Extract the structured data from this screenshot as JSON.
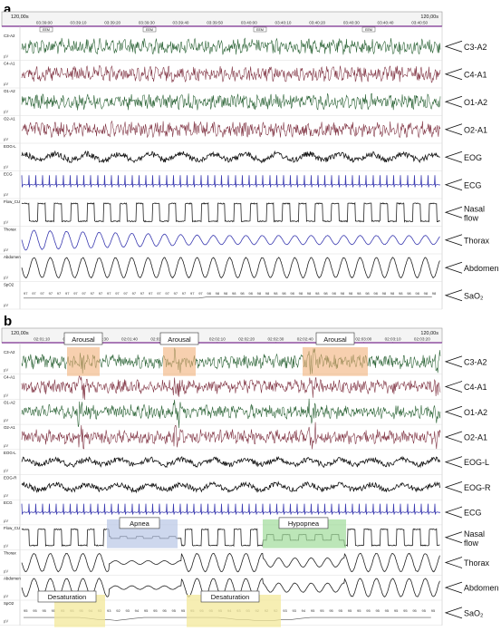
{
  "panel_a": {
    "letter": "a",
    "duration_left": "120,00s",
    "duration_right": "120,00s",
    "time_ticks": [
      "03:39:00",
      "03:39:10",
      "03:39:20",
      "03:39:30",
      "03:39:40",
      "03:39:50",
      "03:40:00",
      "03:40:10",
      "03:40:20",
      "03:40:30",
      "03:40:40",
      "03:40:50"
    ],
    "markers": [
      "EEM",
      "EEM",
      "EEM",
      "EEM",
      "EEM"
    ],
    "channels": [
      {
        "name": "C3-A2",
        "small": "C3-A2",
        "color": "#1f5a2a",
        "type": "eeg"
      },
      {
        "name": "C4-A1",
        "small": "C4-A1",
        "color": "#7a2a3a",
        "type": "eeg"
      },
      {
        "name": "O1-A2",
        "small": "O1-A2",
        "color": "#1f5a2a",
        "type": "eeg"
      },
      {
        "name": "O2-A1",
        "small": "O2-A1",
        "color": "#7a2a3a",
        "type": "eeg"
      },
      {
        "name": "EOG",
        "small": "EOG-L",
        "color": "#111111",
        "type": "eog"
      },
      {
        "name": "ECG",
        "small": "ECG",
        "color": "#3a3ab0",
        "type": "ecg"
      },
      {
        "name": "Nasal flow",
        "small": "Flow_CU",
        "color": "#222222",
        "type": "flow"
      },
      {
        "name": "Thorax",
        "small": "Thorax",
        "color": "#3a3ab0",
        "type": "resp"
      },
      {
        "name": "Abdomen",
        "small": "Abdomen",
        "color": "#222222",
        "type": "resp"
      },
      {
        "name": "SaO₂",
        "small": "SpO2",
        "color": "#222222",
        "type": "sao2"
      }
    ],
    "sao2_values": [
      "97",
      "97",
      "97",
      "97",
      "97",
      "97",
      "97",
      "97",
      "97",
      "97",
      "97",
      "97",
      "97",
      "97",
      "97",
      "97",
      "97",
      "97",
      "97",
      "97",
      "97",
      "97",
      "98",
      "98",
      "98",
      "98",
      "98",
      "98",
      "98",
      "98",
      "98",
      "98",
      "98",
      "98",
      "98",
      "98",
      "98",
      "98",
      "98",
      "98",
      "98",
      "98",
      "98",
      "98",
      "98",
      "98",
      "98",
      "98",
      "98",
      "98"
    ]
  },
  "panel_b": {
    "letter": "b",
    "duration_left": "120,00s",
    "duration_right": "120,00s",
    "time_ticks": [
      "02:01:10",
      "02:01:20",
      "02:01:30",
      "02:01:40",
      "02:01:50",
      "02:02:00",
      "02:02:10",
      "02:02:20",
      "02:02:30",
      "02:02:40",
      "02:02:50",
      "02:03:00",
      "02:03:10",
      "02:03:20"
    ],
    "channels": [
      {
        "name": "C3-A2",
        "small": "C3-A2",
        "color": "#1f5a2a",
        "type": "eeg"
      },
      {
        "name": "C4-A1",
        "small": "C4-A1",
        "color": "#7a2a3a",
        "type": "eeg"
      },
      {
        "name": "O1-A2",
        "small": "O1-A2",
        "color": "#1f5a2a",
        "type": "eeg"
      },
      {
        "name": "O2-A1",
        "small": "O2-A1",
        "color": "#7a2a3a",
        "type": "eeg"
      },
      {
        "name": "EOG-L",
        "small": "EOG-L",
        "color": "#111111",
        "type": "eog"
      },
      {
        "name": "EOG-R",
        "small": "EOG-R",
        "color": "#111111",
        "type": "eog"
      },
      {
        "name": "ECG",
        "small": "ECG",
        "color": "#3a3ab0",
        "type": "ecg"
      },
      {
        "name": "Nasal flow",
        "small": "Flow_CU",
        "color": "#222222",
        "type": "flow"
      },
      {
        "name": "Thorax",
        "small": "Thorax",
        "color": "#222222",
        "type": "resp"
      },
      {
        "name": "Abdomen",
        "small": "Abdomen",
        "color": "#222222",
        "type": "resp"
      },
      {
        "name": "SaO₂",
        "small": "SpO2",
        "color": "#222222",
        "type": "sao2"
      }
    ],
    "annotations": [
      {
        "label": "Arousal",
        "kind": "arousal"
      },
      {
        "label": "Arousal",
        "kind": "arousal"
      },
      {
        "label": "Arousal",
        "kind": "arousal"
      },
      {
        "label": "Apnea",
        "kind": "apnea"
      },
      {
        "label": "Hypopnea",
        "kind": "hypopnea"
      },
      {
        "label": "Desaturation",
        "kind": "desaturation"
      },
      {
        "label": "Desaturation",
        "kind": "desaturation"
      }
    ],
    "sao2_values": [
      "95",
      "95",
      "95",
      "95",
      "95",
      "95",
      "95",
      "94",
      "93",
      "93",
      "92",
      "93",
      "94",
      "95",
      "95",
      "95",
      "95",
      "95",
      "95",
      "95",
      "95",
      "95",
      "94",
      "93",
      "93",
      "92",
      "92",
      "92",
      "93",
      "93",
      "94",
      "95",
      "95",
      "95",
      "95",
      "95",
      "95",
      "95",
      "95",
      "95",
      "95",
      "95",
      "95",
      "95",
      "95"
    ],
    "colors": {
      "arousal": "#f2b07a",
      "apnea": "#b8c6e6",
      "hypopnea": "#9fdc9a",
      "desaturation": "#f3e89a"
    }
  }
}
